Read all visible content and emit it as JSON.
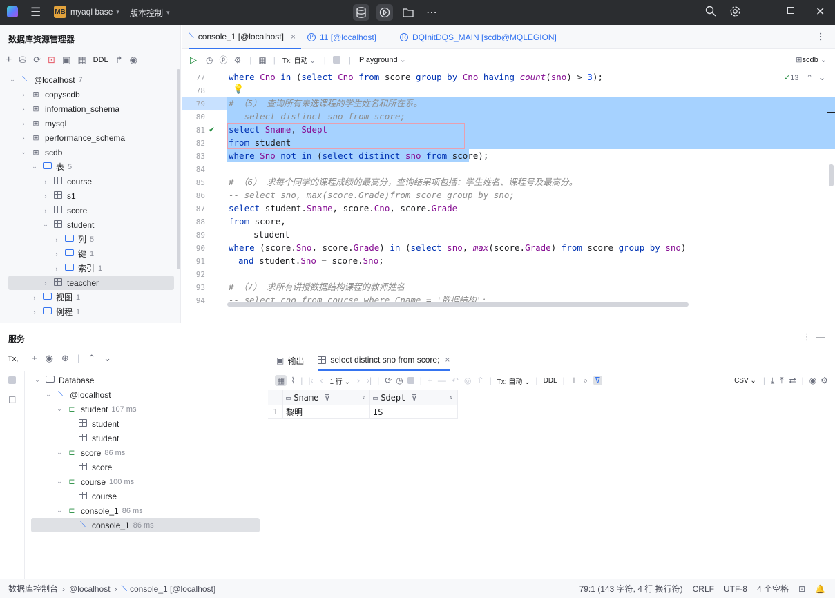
{
  "titlebar": {
    "project_badge": "MB",
    "project_name": "myaql base",
    "vcs_label": "版本控制"
  },
  "explorer": {
    "title": "数据库资源管理器",
    "toolbar_ddl": "DDL",
    "tree": [
      {
        "label": "@localhost",
        "count": "7"
      },
      {
        "label": "copyscdb"
      },
      {
        "label": "information_schema"
      },
      {
        "label": "mysql"
      },
      {
        "label": "performance_schema"
      },
      {
        "label": "scdb"
      },
      {
        "label": "表",
        "count": "5"
      },
      {
        "label": "course"
      },
      {
        "label": "s1"
      },
      {
        "label": "score"
      },
      {
        "label": "student"
      },
      {
        "label": "列",
        "count": "5"
      },
      {
        "label": "键",
        "count": "1"
      },
      {
        "label": "索引",
        "count": "1"
      },
      {
        "label": "teaccher"
      },
      {
        "label": "视图",
        "count": "1"
      },
      {
        "label": "例程",
        "count": "1"
      }
    ]
  },
  "editor": {
    "tabs": [
      {
        "label": "console_1 [@localhost]"
      },
      {
        "label": "11 [@localhost]"
      },
      {
        "label": "DQInitDQS_MAIN [scdb@MQLEGION]"
      }
    ],
    "toolbar": {
      "tx_label": "Tx: 自动",
      "playground_label": "Playground",
      "schema_label": "scdb"
    },
    "inspection_count": "13",
    "line_numbers": [
      "77",
      "78",
      "79",
      "80",
      "81",
      "82",
      "83",
      "84",
      "85",
      "86",
      "87",
      "88",
      "89",
      "90",
      "91",
      "92",
      "93",
      "94"
    ],
    "lines": {
      "l77": [
        "where",
        "Cno",
        "in",
        "(",
        "select",
        "Cno",
        "from",
        "score",
        "group by",
        "Cno",
        "having",
        "count",
        "(",
        "sno",
        ") > ",
        "3",
        ");"
      ],
      "l79": "# （5） 查询所有未选课程的学生姓名和所在系。",
      "l80": "-- select distinct sno from score;",
      "l81": [
        "select",
        "Sname",
        ", ",
        "Sdept"
      ],
      "l82": [
        "from",
        "student"
      ],
      "l83": [
        "where",
        "Sno",
        "not in",
        "(",
        "select distinct",
        "sno",
        "from",
        "score);"
      ],
      "l85": "# （6） 求每个同学的课程成绩的最高分，查询结果项包括：学生姓名、课程号及最高分。",
      "l86": "-- select sno, max(score.Grade)from score group by sno;",
      "l87": [
        "select",
        "student.",
        "Sname",
        ", score.",
        "Cno",
        ", score.",
        "Grade"
      ],
      "l88": [
        "from",
        "score,"
      ],
      "l89": "student",
      "l90": [
        "where",
        "(score.",
        "Sno",
        ", score.",
        "Grade",
        ") ",
        "in",
        " (",
        "select",
        "sno",
        ", ",
        "max",
        "(score.",
        "Grade",
        ") ",
        "from",
        "score",
        "group by",
        "sno",
        ")"
      ],
      "l91": [
        "and",
        "student.",
        "Sno",
        " = score.",
        "Sno",
        ";"
      ],
      "l93": "# （7） 求所有讲授数据结构课程的教师姓名",
      "l94": "-- select cno from course where Cname = '数据结构';"
    }
  },
  "services": {
    "title": "服务",
    "tx_label": "Tx,",
    "tree": [
      {
        "label": "Database"
      },
      {
        "label": "@localhost"
      },
      {
        "label": "student",
        "time": "107 ms"
      },
      {
        "label": "student"
      },
      {
        "label": "student"
      },
      {
        "label": "score",
        "time": "86 ms"
      },
      {
        "label": "score"
      },
      {
        "label": "course",
        "time": "100 ms"
      },
      {
        "label": "course"
      },
      {
        "label": "console_1",
        "time": "86 ms"
      },
      {
        "label": "console_1",
        "time": "86 ms"
      }
    ],
    "result_tabs": [
      {
        "label": "输出"
      },
      {
        "label": "select distinct sno from score;"
      }
    ],
    "result_toolbar": {
      "rows_label": "1 行",
      "tx_label": "Tx: 自动",
      "ddl_label": "DDL",
      "csv_label": "CSV"
    },
    "grid": {
      "columns": [
        "Sname",
        "Sdept"
      ],
      "rows": [
        {
          "index": "1",
          "cells": [
            "黎明",
            "IS"
          ]
        }
      ]
    }
  },
  "statusbar": {
    "breadcrumb": [
      "数据库控制台",
      "@localhost",
      "console_1 [@localhost]"
    ],
    "position": "79:1 (143 字符, 4 行 换行符)",
    "line_sep": "CRLF",
    "encoding": "UTF-8",
    "indent": "4 个空格"
  }
}
